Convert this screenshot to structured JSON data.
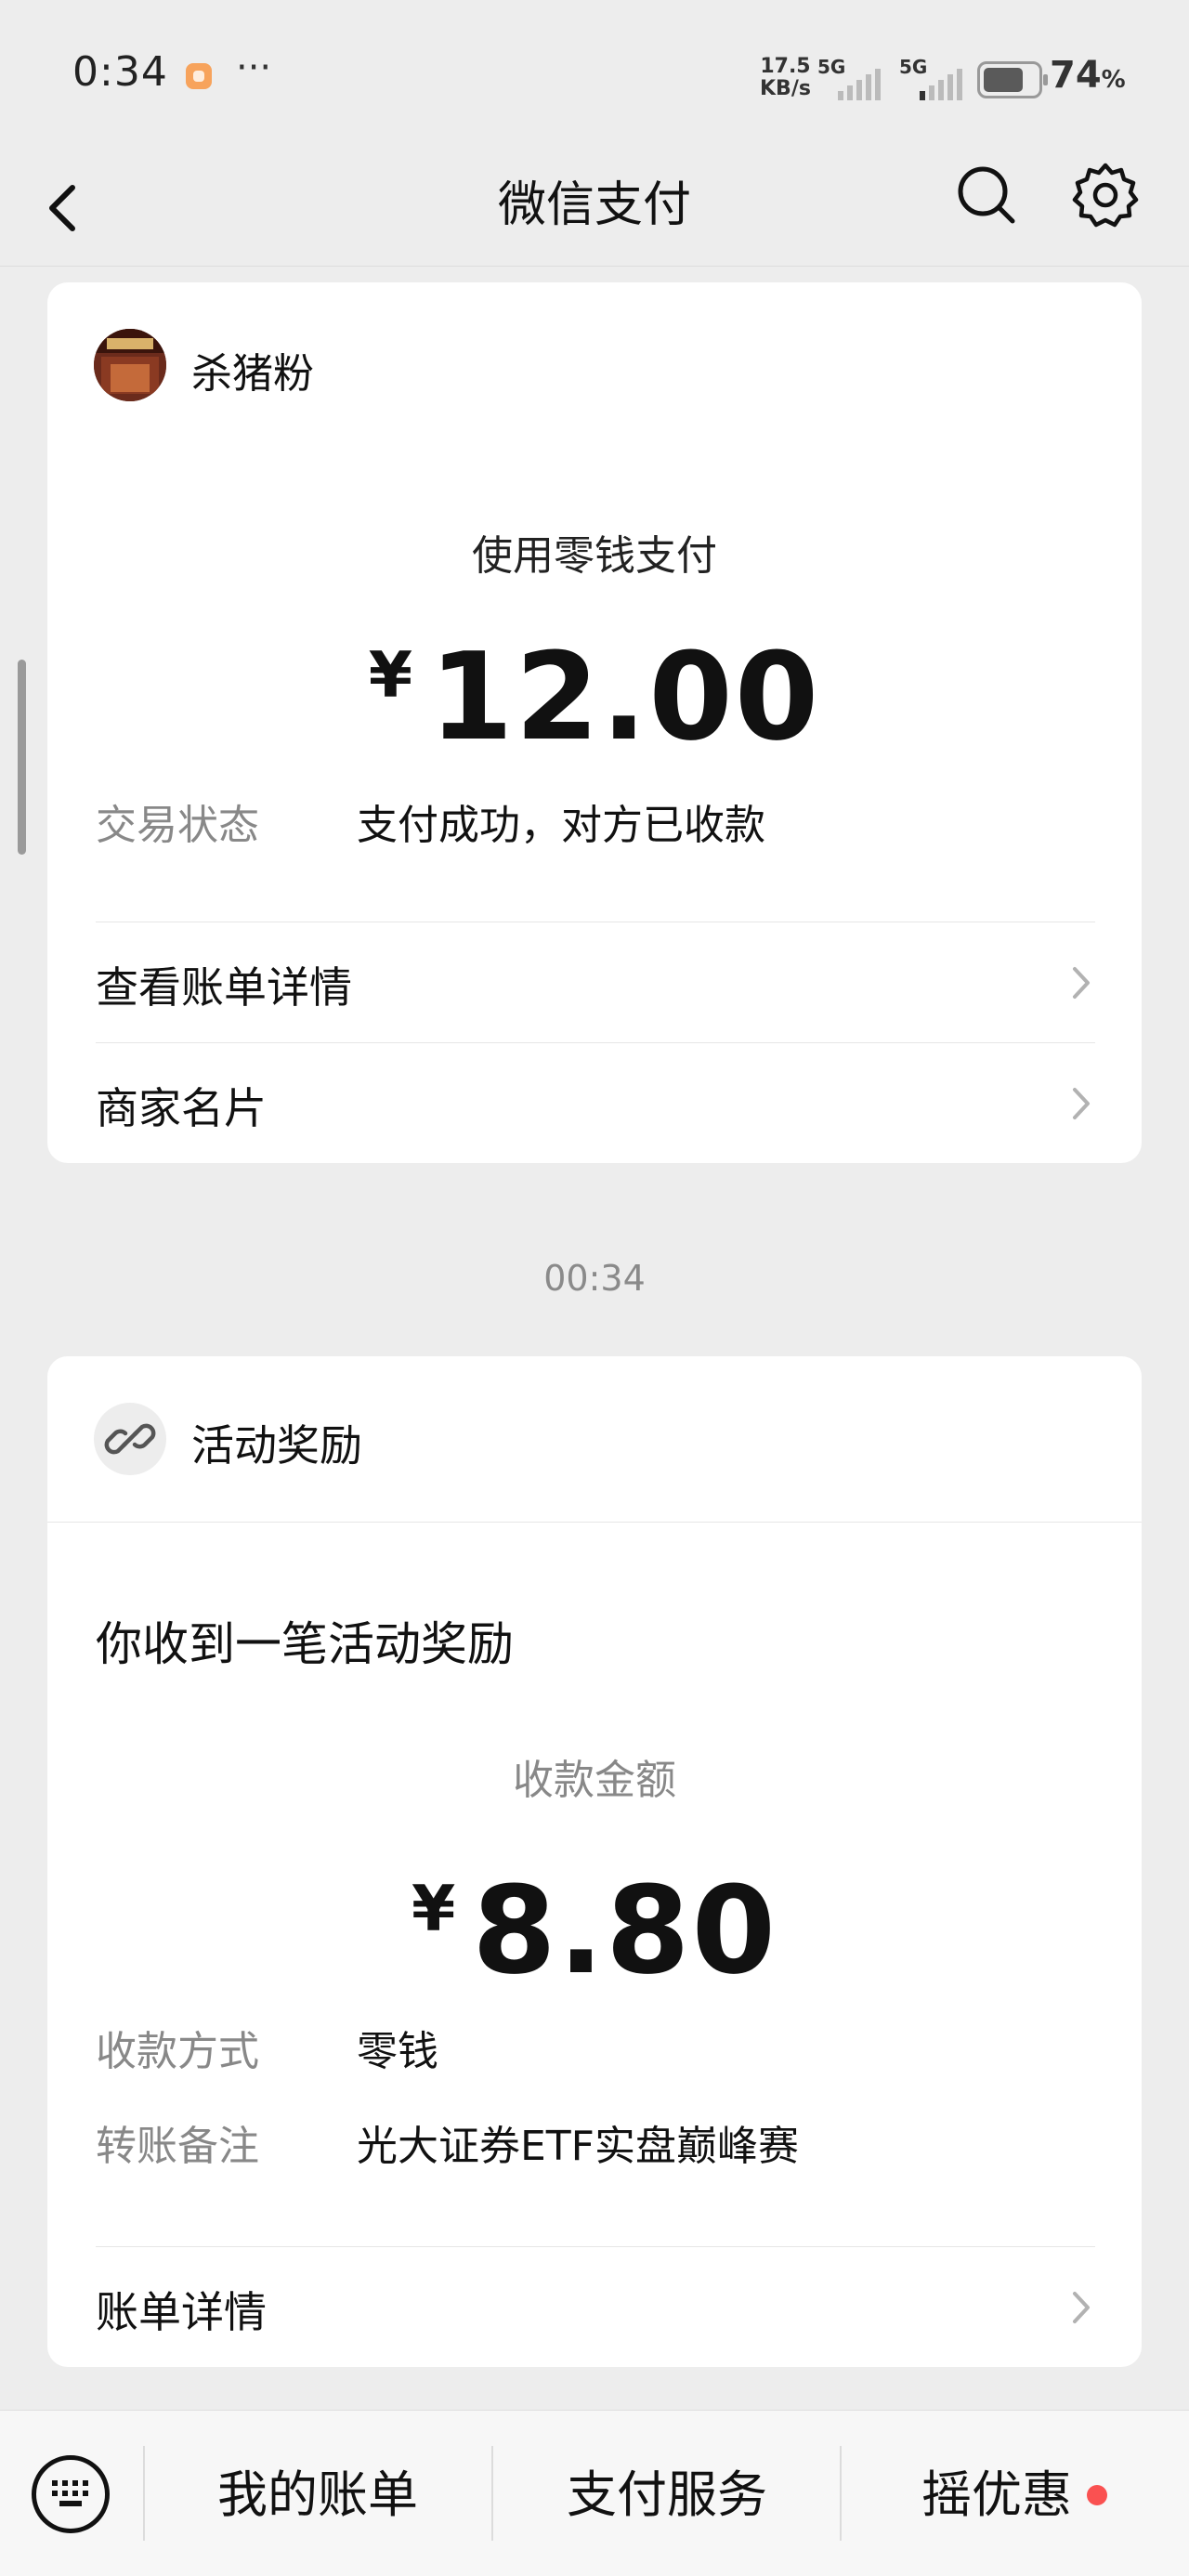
{
  "status_bar": {
    "time": "0:34",
    "more": "···",
    "net_speed_value": "17.5",
    "net_speed_unit": "KB/s",
    "signal1_label": "5G",
    "signal2_label": "5G",
    "battery_percent": "74",
    "battery_percent_sign": "%"
  },
  "nav": {
    "title": "微信支付"
  },
  "payment_card": {
    "merchant_name": "杀猪粉",
    "pay_method": "使用零钱支付",
    "currency": "¥",
    "amount": "12.00",
    "status_label": "交易状态",
    "status_value": "支付成功，对方已收款",
    "links": [
      {
        "label": "查看账单详情"
      },
      {
        "label": "商家名片"
      }
    ]
  },
  "time_separator": "00:34",
  "reward_card": {
    "title": "活动奖励",
    "headline": "你收到一笔活动奖励",
    "amount_label": "收款金额",
    "currency": "¥",
    "amount": "8.80",
    "rows": [
      {
        "label": "收款方式",
        "value": "零钱"
      },
      {
        "label": "转账备注",
        "value": "光大证券ETF实盘巅峰赛"
      }
    ],
    "link": {
      "label": "账单详情"
    }
  },
  "bottom_menu": {
    "items": [
      {
        "label": "我的账单"
      },
      {
        "label": "支付服务"
      },
      {
        "label": "摇优惠"
      }
    ]
  },
  "colors": {
    "background": "#ededed",
    "card": "#ffffff",
    "secondary_text": "#888888",
    "badge_red": "#fa5151"
  }
}
